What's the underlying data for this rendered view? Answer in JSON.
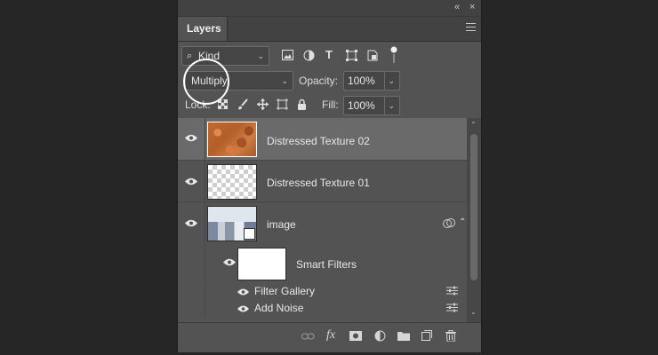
{
  "panel": {
    "collapse_glyph": "«",
    "close_glyph": "×",
    "tab_label": "Layers",
    "menu_icon": "hamburger-icon"
  },
  "filter": {
    "kind_label": "Kind",
    "icons": [
      "pixel-filter-icon",
      "adjustment-filter-icon",
      "type-filter-icon",
      "shape-filter-icon",
      "smart-object-filter-icon",
      "filter-toggle-icon"
    ]
  },
  "blend": {
    "mode": "Multiply",
    "opacity_label": "Opacity:",
    "opacity_value": "100%"
  },
  "lock": {
    "label": "Lock:",
    "icons": [
      "lock-transparent-icon",
      "lock-image-icon",
      "lock-position-icon",
      "lock-artboard-icon",
      "lock-all-icon"
    ],
    "fill_label": "Fill:",
    "fill_value": "100%"
  },
  "layers": [
    {
      "name": "Distressed Texture 02",
      "visible": true,
      "selected": true,
      "thumbnail": "texture"
    },
    {
      "name": "Distressed Texture 01",
      "visible": true,
      "selected": false,
      "thumbnail": "transparent"
    },
    {
      "name": "image",
      "visible": true,
      "selected": false,
      "thumbnail": "photo",
      "smart_object": true
    },
    {
      "name": "Smart Filters",
      "visible": true,
      "selected": false,
      "thumbnail": "mask"
    }
  ],
  "filters": [
    {
      "name": "Filter Gallery",
      "visible": true
    },
    {
      "name": "Add Noise",
      "visible": true
    }
  ],
  "bottom_icons": [
    "link-layers-icon",
    "fx-icon",
    "add-mask-icon",
    "adjustment-layer-icon",
    "group-folder-icon",
    "new-layer-icon",
    "trash-icon"
  ],
  "glyphs": {
    "eye": "👁",
    "fx": "fx",
    "text_tool": "T"
  }
}
